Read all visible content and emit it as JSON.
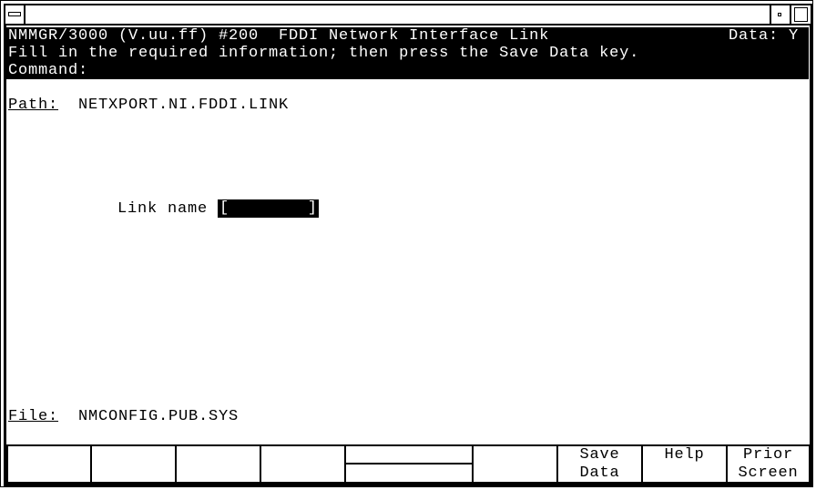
{
  "window": {
    "system_menu_icon": "system-menu-icon",
    "minimize_icon": "minimize-icon",
    "maximize_icon": "maximize-icon"
  },
  "header": {
    "title": "NMMGR/3000 (V.uu.ff) #200  FDDI Network Interface Link",
    "data_flag": "Data: Y",
    "instruction": "Fill in the required information; then press the Save Data key.",
    "command_label": "Command:"
  },
  "path": {
    "label": "Path:",
    "value": "NETXPORT.NI.FDDI.LINK"
  },
  "form": {
    "link_name_label": "Link name",
    "link_name_value": "",
    "left_bracket": "[",
    "right_bracket": "]"
  },
  "file": {
    "label": "File:",
    "value": "NMCONFIG.PUB.SYS"
  },
  "softkeys": [
    {
      "line1": "",
      "line2": ""
    },
    {
      "line1": "",
      "line2": ""
    },
    {
      "line1": "",
      "line2": ""
    },
    {
      "line1": "",
      "line2": ""
    },
    {
      "line1": "",
      "line2": ""
    },
    {
      "line1": "",
      "line2": ""
    },
    {
      "line1": "Save",
      "line2": "Data"
    },
    {
      "line1": "Help",
      "line2": ""
    },
    {
      "line1": "Prior",
      "line2": "Screen"
    }
  ]
}
